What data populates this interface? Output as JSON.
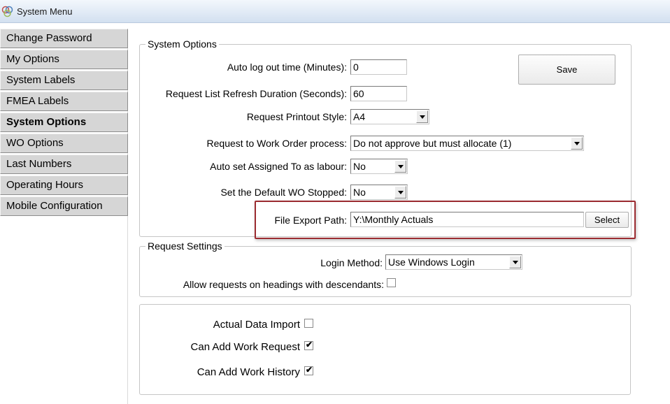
{
  "window": {
    "title": "System Menu"
  },
  "sidebar": {
    "items": [
      {
        "label": "Change Password"
      },
      {
        "label": "My Options"
      },
      {
        "label": "System Labels"
      },
      {
        "label": "FMEA Labels"
      },
      {
        "label": "System Options"
      },
      {
        "label": "WO Options"
      },
      {
        "label": "Last Numbers"
      },
      {
        "label": "Operating Hours"
      },
      {
        "label": "Mobile Configuration"
      }
    ],
    "active": "System Options"
  },
  "system_options": {
    "legend": "System Options",
    "save_label": "Save",
    "auto_logout": {
      "label": "Auto log out time (Minutes):",
      "value": "0"
    },
    "refresh_duration": {
      "label": "Request List Refresh Duration (Seconds):",
      "value": "60"
    },
    "printout_style": {
      "label": "Request Printout Style:",
      "value": "A4"
    },
    "request_to_wo": {
      "label": "Request to Work Order process:",
      "value": "Do not approve but must allocate (1)"
    },
    "auto_assigned": {
      "label": "Auto set Assigned To as labour:",
      "value": "No"
    },
    "default_wo_stopped": {
      "label": "Set the Default WO Stopped:",
      "value": "No"
    },
    "file_export": {
      "label": "File Export Path:",
      "value": "Y:\\Monthly Actuals",
      "select_label": "Select"
    }
  },
  "request_settings": {
    "legend": "Request Settings",
    "login_method": {
      "label": "Login Method:",
      "value": "Use Windows Login"
    },
    "allow_headings": {
      "label": "Allow requests on headings with descendants:",
      "checked": false
    }
  },
  "import_settings": {
    "actual_data_import": {
      "label": "Actual Data Import",
      "checked": false
    },
    "can_add_work_request": {
      "label": "Can Add Work Request",
      "checked": true,
      "mark": "✔"
    },
    "can_add_work_history": {
      "label": "Can Add Work History",
      "checked": true,
      "mark": "✔"
    }
  }
}
